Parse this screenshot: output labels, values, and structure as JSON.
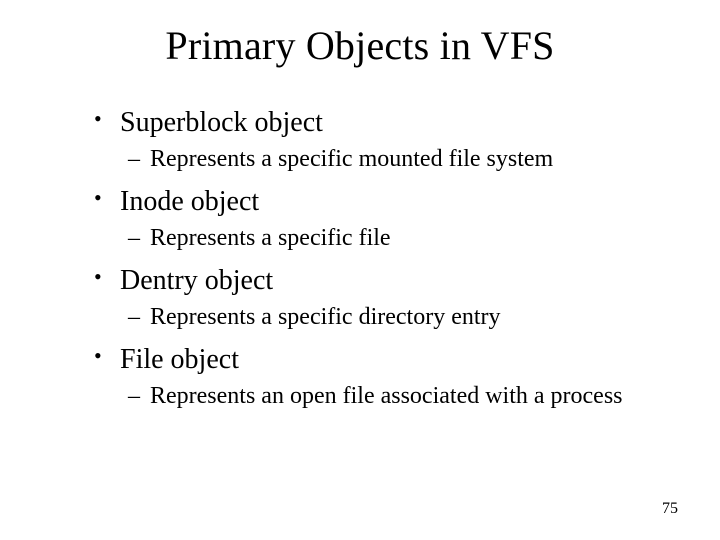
{
  "title": "Primary Objects in VFS",
  "items": [
    {
      "label": "Superblock object",
      "sub": "Represents a specific mounted file system"
    },
    {
      "label": "Inode object",
      "sub": "Represents a specific file"
    },
    {
      "label": "Dentry object",
      "sub": "Represents a specific directory entry"
    },
    {
      "label": "File object",
      "sub": "Represents an open file associated with a process"
    }
  ],
  "page_number": "75"
}
